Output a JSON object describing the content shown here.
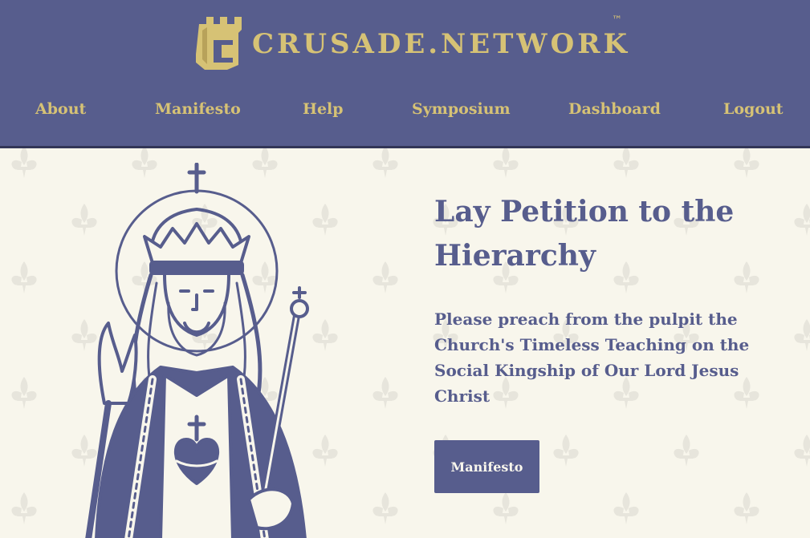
{
  "header": {
    "brand": "CRUSADE.NETWORK",
    "trademark": "™",
    "logo_icon": "castle-tower-c-icon",
    "nav": [
      {
        "label": "About"
      },
      {
        "label": "Manifesto"
      },
      {
        "label": "Help"
      },
      {
        "label": "Symposium"
      },
      {
        "label": "Dashboard"
      },
      {
        "label": "Logout"
      }
    ]
  },
  "hero": {
    "title": "Lay Petition to the Hierarchy",
    "subtitle": "Please preach from the pulpit the Church's Timeless Teaching on the Social Kingship of Our Lord Jesus Christ",
    "cta_label": "Manifesto",
    "illustration": "christ-the-king-illustration",
    "background_pattern": "fleur-de-lis-pattern"
  },
  "colors": {
    "header_bg": "#575d8d",
    "accent_gold": "#d6c275",
    "page_bg": "#f8f6ec",
    "primary_text": "#575d8d"
  }
}
